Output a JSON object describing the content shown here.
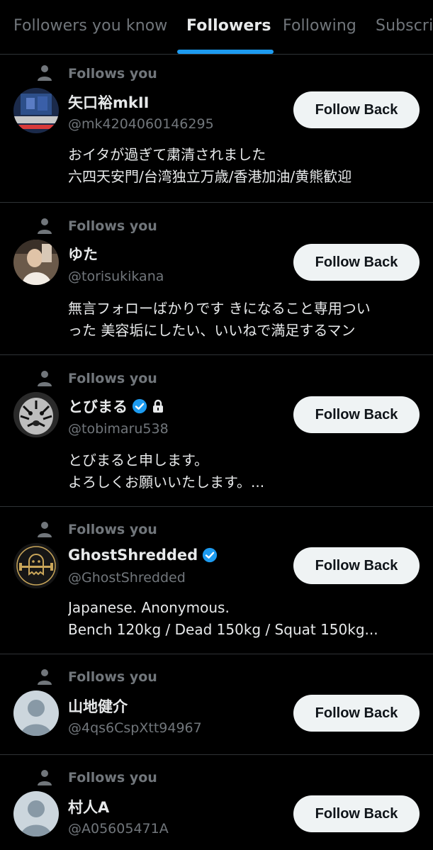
{
  "tabs": [
    {
      "label": "Followers you know",
      "active": false
    },
    {
      "label": "Followers",
      "active": true
    },
    {
      "label": "Following",
      "active": false
    },
    {
      "label": "Subscri",
      "active": false
    }
  ],
  "follows_you_label": "Follows you",
  "follow_back_label": "Follow Back",
  "accent_color": "#1d9bf0",
  "users": [
    {
      "name": "矢口裕mkII",
      "handle": "@mk4204060146295",
      "verified": false,
      "protected": false,
      "avatar": "avatar-robot-photo",
      "bio": [
        "おイタが過ぎて粛清されました",
        "六四天安門/台湾独立万歳/香港加油/黄熊歓迎"
      ]
    },
    {
      "name": "ゆた",
      "handle": "@torisukikana",
      "verified": false,
      "protected": false,
      "avatar": "avatar-person-photo",
      "bio": [
        "無言フォローばかりです きになること専用つい",
        "った 美容垢にしたい、いいねで満足するマン"
      ]
    },
    {
      "name": "とびまる",
      "handle": "@tobimaru538",
      "verified": true,
      "protected": true,
      "avatar": "avatar-tiger-photo",
      "bio": [
        "とびまると申します。",
        "よろしくお願いいたします。..."
      ]
    },
    {
      "name": "GhostShredded",
      "handle": "@GhostShredded",
      "verified": true,
      "protected": false,
      "avatar": "avatar-ghost-lifter-logo",
      "bio": [
        "Japanese. Anonymous.",
        "Bench 120kg / Dead 150kg / Squat 150kg..."
      ]
    },
    {
      "name": "山地健介",
      "handle": "@4qs6CspXtt94967",
      "verified": false,
      "protected": false,
      "avatar": "default-avatar",
      "bio": []
    },
    {
      "name": "村人A",
      "handle": "@A05605471A",
      "verified": false,
      "protected": false,
      "avatar": "default-avatar",
      "bio": []
    }
  ]
}
